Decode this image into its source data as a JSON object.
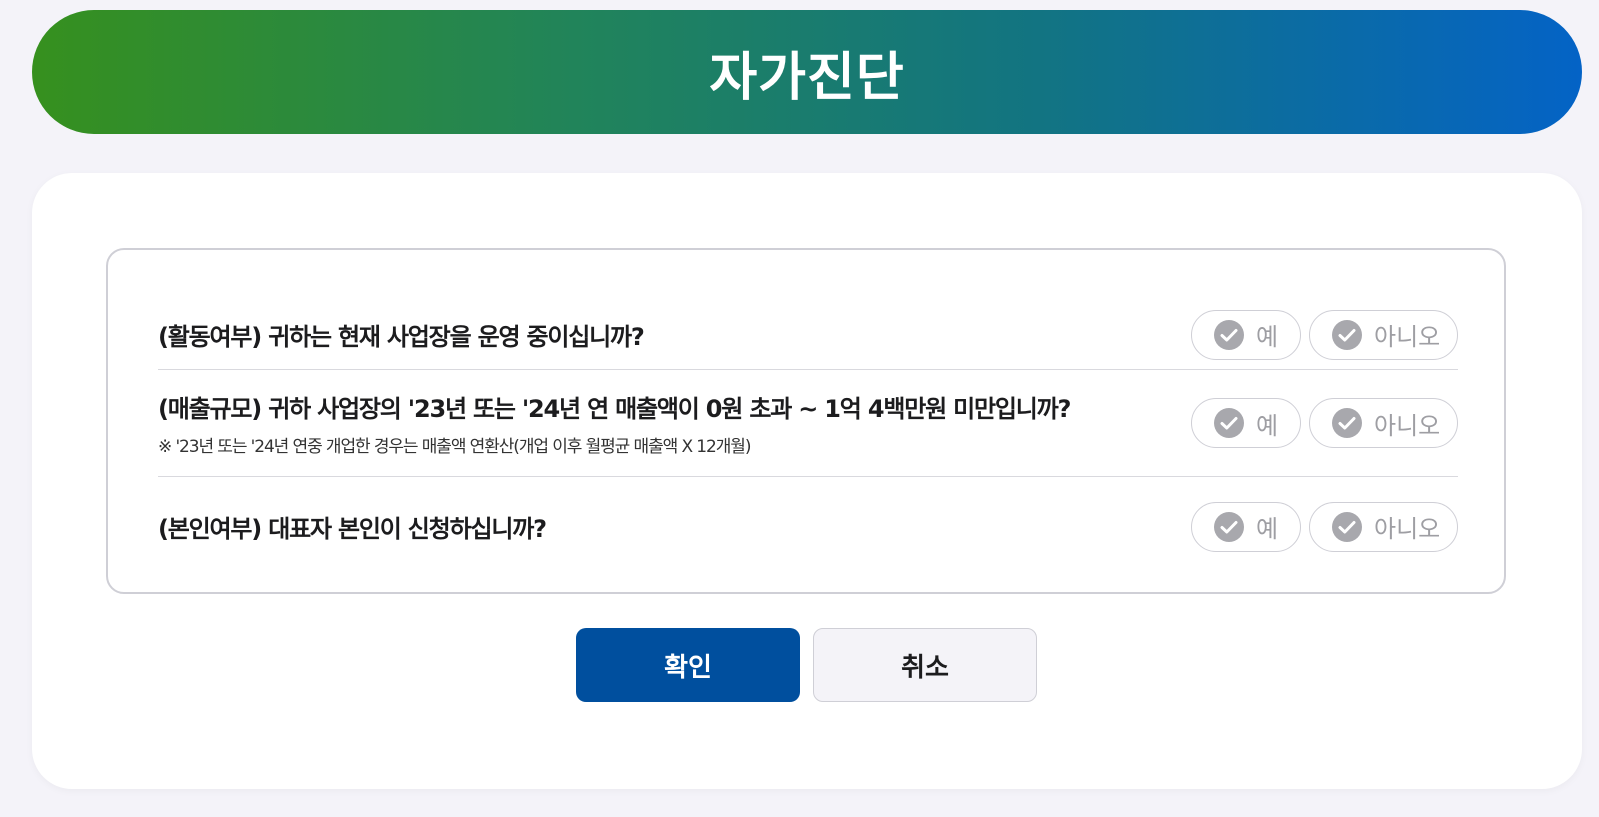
{
  "header": {
    "title": "자가진단"
  },
  "colors": {
    "gradient_start": "#36901e",
    "gradient_end": "#0463c6",
    "confirm_button": "#004f9e",
    "check_icon": "#a8a8ad"
  },
  "questions": [
    {
      "text": "(활동여부) 귀하는 현재 사업장을 운영 중이십니까?",
      "note": "",
      "options": {
        "yes": "예",
        "no": "아니오"
      }
    },
    {
      "text": "(매출규모) 귀하 사업장의 '23년 또는 '24년 연 매출액이 0원 초과 ~ 1억 4백만원 미만입니까?",
      "note": "※ '23년 또는 '24년 연중 개업한 경우는 매출액 연환산(개업 이후 월평균 매출액 X 12개월)",
      "options": {
        "yes": "예",
        "no": "아니오"
      }
    },
    {
      "text": "(본인여부) 대표자 본인이 신청하십니까?",
      "note": "",
      "options": {
        "yes": "예",
        "no": "아니오"
      }
    }
  ],
  "buttons": {
    "confirm": "확인",
    "cancel": "취소"
  },
  "icons": {
    "option_icon": "check-circle-icon"
  }
}
